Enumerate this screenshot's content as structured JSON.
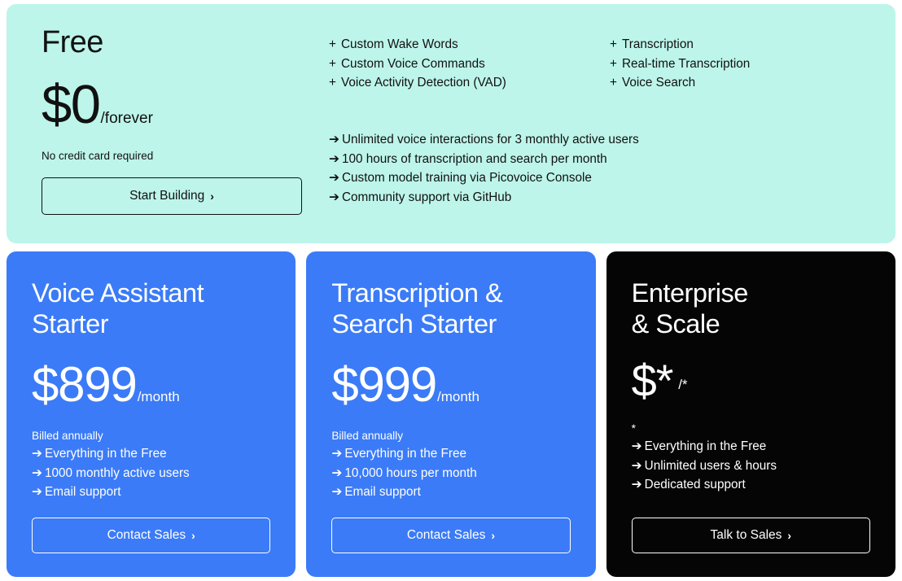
{
  "colors": {
    "free_card_bg": "#bdf5ea",
    "starter_card_bg": "#3b7bf7",
    "enterprise_card_bg": "#050505",
    "page_bg": "#ffffff",
    "dark_text": "#111111",
    "light_text": "#ffffff"
  },
  "free_plan": {
    "title": "Free",
    "price_amount": "$0",
    "price_unit": "/forever",
    "note": "No credit card required",
    "cta_label": "Start Building",
    "cta_chevron": "›",
    "features_column_1": [
      {
        "marker": "+",
        "label": "Custom Wake Words"
      },
      {
        "marker": "+",
        "label": "Custom Voice Commands"
      },
      {
        "marker": "+",
        "label": "Voice Activity Detection (VAD)"
      }
    ],
    "features_column_2": [
      {
        "marker": "+",
        "label": "Transcription"
      },
      {
        "marker": "+",
        "label": "Real-time Transcription"
      },
      {
        "marker": "+",
        "label": "Voice Search"
      }
    ],
    "limits": [
      {
        "marker": "➔",
        "label": "Unlimited voice interactions for 3 monthly active users"
      },
      {
        "marker": "➔",
        "label": "100 hours of transcription and search per month"
      },
      {
        "marker": "➔",
        "label": "Custom model training via Picovoice Console"
      },
      {
        "marker": "➔",
        "label": "Community support via GitHub"
      }
    ]
  },
  "plans": [
    {
      "title_line_1": "Voice Assistant",
      "title_line_2": "Starter",
      "price_amount": "$899",
      "price_unit": "/month",
      "billing_note": "Billed annually",
      "features": [
        {
          "marker": "➔",
          "label": "Everything in the Free"
        },
        {
          "marker": "➔",
          "label": "1000 monthly active users"
        },
        {
          "marker": "➔",
          "label": "Email support"
        }
      ],
      "cta_label": "Contact Sales",
      "cta_chevron": "›"
    },
    {
      "title_line_1": "Transcription &",
      "title_line_2": "Search Starter",
      "price_amount": "$999",
      "price_unit": "/month",
      "billing_note": "Billed annually",
      "features": [
        {
          "marker": "➔",
          "label": "Everything in the Free"
        },
        {
          "marker": "➔",
          "label": "10,000 hours per month"
        },
        {
          "marker": "➔",
          "label": "Email support"
        }
      ],
      "cta_label": "Contact Sales",
      "cta_chevron": "›"
    },
    {
      "title_line_1": "Enterprise",
      "title_line_2": "& Scale",
      "price_amount": "$*",
      "price_unit": "/*",
      "billing_note": "*",
      "features": [
        {
          "marker": "➔",
          "label": "Everything in the Free"
        },
        {
          "marker": "➔",
          "label": "Unlimited users & hours"
        },
        {
          "marker": "➔",
          "label": "Dedicated support"
        }
      ],
      "cta_label": "Talk to Sales",
      "cta_chevron": "›"
    }
  ]
}
